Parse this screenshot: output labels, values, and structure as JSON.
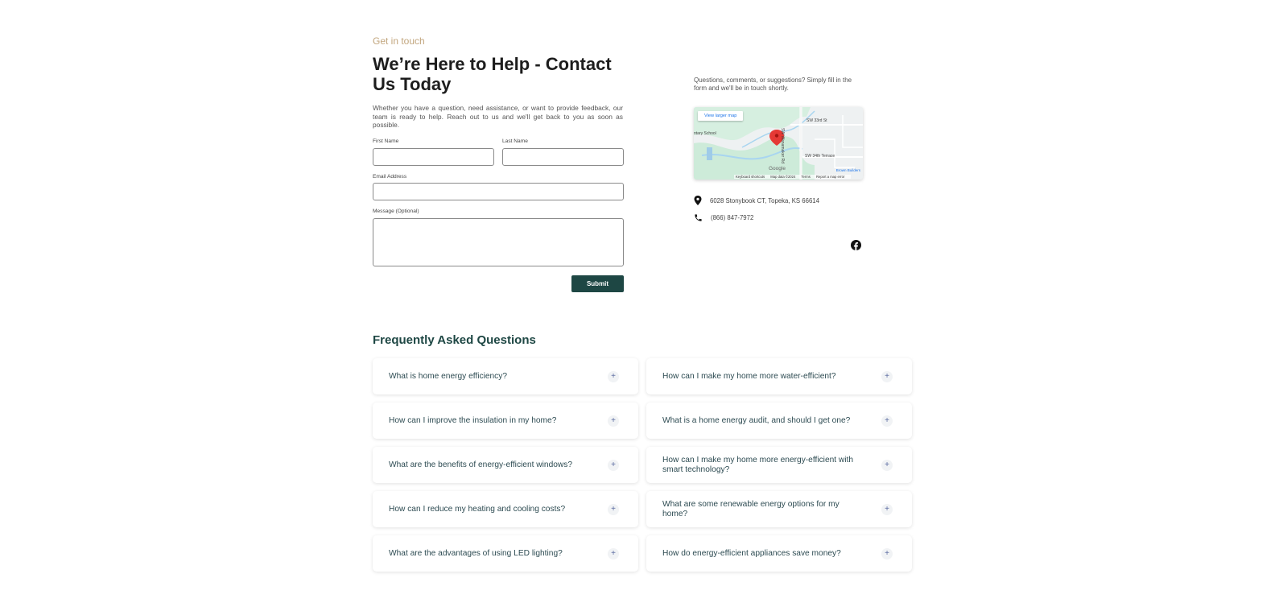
{
  "hero": {
    "eyebrow": "Get in touch",
    "title": "We’re Here to Help - Contact Us Today",
    "description": "Whether you have a question, need assistance, or want to provide feedback, our team is ready to help. Reach out to us and we'll get back to you as soon as possible."
  },
  "form": {
    "first_name_label": "First Name",
    "first_name_value": "",
    "last_name_label": "Last Name",
    "last_name_value": "",
    "email_label": "Email Address",
    "email_value": "",
    "message_label": "Message (Optional)",
    "message_value": "",
    "submit_label": "Submit"
  },
  "contact": {
    "blurb": "Questions, comments, or suggestions? Simply fill in the form and we'll be in touch shortly.",
    "address": "6028 Stonybook CT, Topeka, KS 66614",
    "phone": "(866) 847-7972",
    "address_icon": "location-pin-icon",
    "phone_icon": "phone-icon",
    "social_icon": "facebook-icon"
  },
  "map": {
    "link": "View larger map",
    "label_school": "ntary School",
    "label_street1": "SW 33rd St",
    "label_street2": "SW 34th Terrace",
    "label_road": "SW Wanamaker Rd",
    "google": "Google",
    "keyboard": "Keyboard shortcuts",
    "mapdata": "Map data ©2024",
    "terms": "Terms",
    "report": "Report a map error",
    "corner": "Brown Builders"
  },
  "faq": {
    "title": "Frequently Asked Questions",
    "items": [
      {
        "q": "What is home energy efficiency?"
      },
      {
        "q": "How can I make my home more water-efficient?"
      },
      {
        "q": "How can I improve the insulation in my home?"
      },
      {
        "q": "What is a home energy audit, and should I get one?"
      },
      {
        "q": "What are the benefits of energy-efficient windows?"
      },
      {
        "q": "How can I make my home more energy-efficient with smart technology?"
      },
      {
        "q": "How can I reduce my heating and cooling costs?"
      },
      {
        "q": "What are some renewable energy options for my home?"
      },
      {
        "q": "What are the advantages of using LED lighting?"
      },
      {
        "q": "How do energy-efficient appliances save money?"
      }
    ],
    "expand_symbol": "+"
  },
  "colors": {
    "accent": "#1e4744",
    "eyebrow": "#c2a67e",
    "map_pin": "#e53935"
  }
}
